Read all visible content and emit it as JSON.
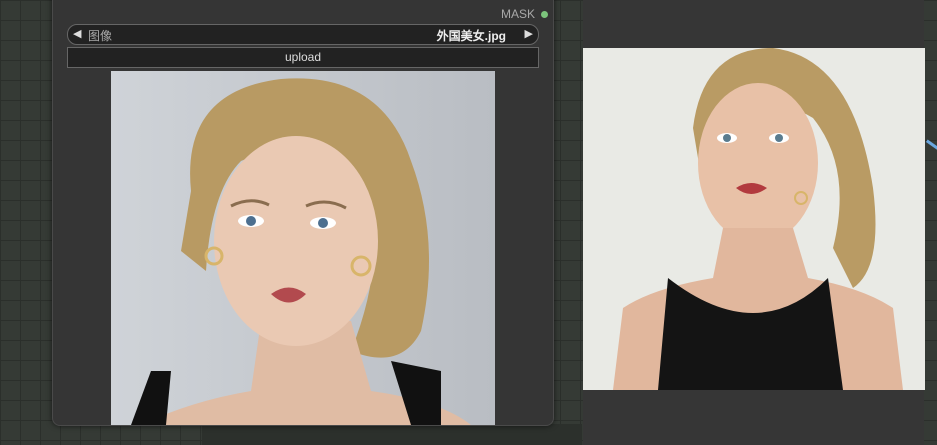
{
  "node": {
    "output_label": "MASK",
    "image_widget": {
      "label": "图像",
      "value": "外国美女.jpg"
    },
    "upload_label": "upload"
  },
  "colors": {
    "canvas": "#353a35",
    "node_bg": "#353535",
    "mask_dot": "#7cc47c",
    "link": "#6aa7e0"
  },
  "icons": [
    "arrow-left-icon",
    "arrow-right-icon",
    "output-dot-icon"
  ]
}
